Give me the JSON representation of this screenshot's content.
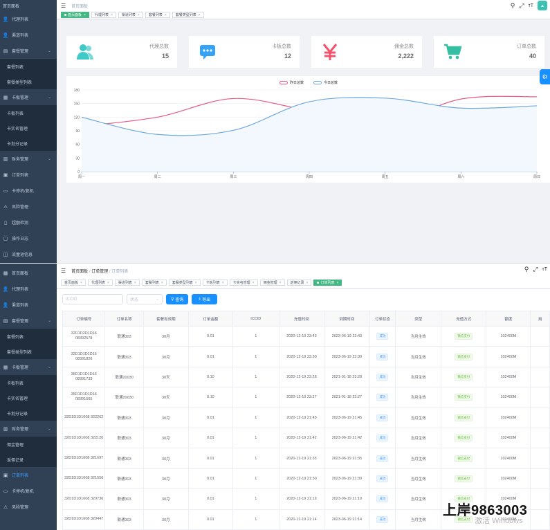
{
  "top": {
    "sidebar": {
      "logo": "首页面板",
      "items": [
        {
          "icon": "user-icon",
          "label": "代理列表",
          "sub": false
        },
        {
          "icon": "user-icon",
          "label": "渠道列表",
          "sub": false
        },
        {
          "icon": "package-icon",
          "label": "套餐管理",
          "sub": false,
          "arrow": true
        },
        {
          "icon": "",
          "label": "套餐列表",
          "sub": true
        },
        {
          "icon": "",
          "label": "套餐类型列表",
          "sub": true
        },
        {
          "icon": "grid-icon",
          "label": "卡板管理",
          "sub": false,
          "arrow": true
        },
        {
          "icon": "",
          "label": "卡板列表",
          "sub": true
        },
        {
          "icon": "",
          "label": "卡实名管理",
          "sub": true
        },
        {
          "icon": "",
          "label": "卡划分记录",
          "sub": true
        },
        {
          "icon": "chart-icon",
          "label": "财务管理",
          "sub": false,
          "arrow": true
        },
        {
          "icon": "cart-icon",
          "label": "订单列表",
          "sub": false
        },
        {
          "icon": "phone-icon",
          "label": "卡停机/复机",
          "sub": false
        },
        {
          "icon": "warn-icon",
          "label": "风险管理",
          "sub": false
        },
        {
          "icon": "doc-icon",
          "label": "超额检测",
          "sub": false
        },
        {
          "icon": "log-icon",
          "label": "操作日志",
          "sub": false
        },
        {
          "icon": "msg-icon",
          "label": "流量池信息",
          "sub": false
        }
      ]
    },
    "breadcrumb": [
      "首页面板"
    ],
    "tags": [
      {
        "label": "首页面板",
        "active": true
      },
      {
        "label": "代理列表",
        "active": false
      },
      {
        "label": "渠道列表",
        "active": false
      },
      {
        "label": "套餐列表",
        "active": false
      },
      {
        "label": "套餐类型列表",
        "active": false
      }
    ],
    "cards": [
      {
        "icon": "users-icon",
        "name": "代理总数",
        "value": "15",
        "color": "#40c9c6"
      },
      {
        "icon": "message-icon",
        "name": "卡板总数",
        "value": "12",
        "color": "#36a3f7"
      },
      {
        "icon": "yen-icon",
        "name": "佣金总数",
        "value": "2,222",
        "color": "#f4516c"
      },
      {
        "icon": "shopping-cart-icon",
        "name": "订单总数",
        "value": "40",
        "color": "#34bfa3"
      }
    ]
  },
  "chart_data": {
    "type": "line",
    "categories": [
      "周一",
      "周二",
      "周三",
      "周四",
      "周五",
      "周六",
      "周日"
    ],
    "series": [
      {
        "name": "昨日总数",
        "values": [
          100,
          120,
          161,
          134,
          105,
          160,
          165
        ],
        "color": "#e85a86"
      },
      {
        "name": "今日总数",
        "values": [
          120,
          82,
          91,
          154,
          162,
          140,
          145
        ],
        "color": "#6fa8dc"
      }
    ],
    "ylim": [
      0,
      180
    ],
    "yticks": [
      "0",
      "30",
      "60",
      "90",
      "120",
      "150",
      "180"
    ],
    "legend": "top-center",
    "grid": true
  },
  "bottom": {
    "sidebar": {
      "items": [
        {
          "icon": "dashboard-icon",
          "label": "首页面板",
          "sub": false
        },
        {
          "icon": "user-icon",
          "label": "代理列表",
          "sub": false
        },
        {
          "icon": "user-icon",
          "label": "渠道列表",
          "sub": false
        },
        {
          "icon": "package-icon",
          "label": "套餐管理",
          "sub": false,
          "arrow": true
        },
        {
          "icon": "",
          "label": "套餐列表",
          "sub": true
        },
        {
          "icon": "",
          "label": "套餐类型列表",
          "sub": true
        },
        {
          "icon": "grid-icon",
          "label": "卡板管理",
          "sub": false,
          "arrow": true
        },
        {
          "icon": "",
          "label": "卡板列表",
          "sub": true
        },
        {
          "icon": "",
          "label": "卡实名管理",
          "sub": true
        },
        {
          "icon": "",
          "label": "卡划分记录",
          "sub": true
        },
        {
          "icon": "chart-icon",
          "label": "财务管理",
          "sub": false,
          "arrow": true
        },
        {
          "icon": "",
          "label": "佣金管理",
          "sub": true
        },
        {
          "icon": "",
          "label": "返佣记录",
          "sub": true
        },
        {
          "icon": "cart-icon",
          "label": "订单列表",
          "sub": false,
          "active": true
        },
        {
          "icon": "phone-icon",
          "label": "卡停机/复机",
          "sub": false
        },
        {
          "icon": "warn-icon",
          "label": "风险管理",
          "sub": false
        }
      ]
    },
    "breadcrumb": [
      "首页面板",
      "订单管理",
      "订单列表"
    ],
    "tags": [
      {
        "label": "首页面板",
        "active": false
      },
      {
        "label": "代理列表",
        "active": false
      },
      {
        "label": "渠道列表",
        "active": false
      },
      {
        "label": "套餐列表",
        "active": false
      },
      {
        "label": "套餐类型列表",
        "active": false
      },
      {
        "label": "卡板列表",
        "active": false
      },
      {
        "label": "卡实名管理",
        "active": false
      },
      {
        "label": "佣金管理",
        "active": false
      },
      {
        "label": "返佣记录",
        "active": false
      },
      {
        "label": "订单列表",
        "active": true
      }
    ],
    "filter": {
      "iccid_placeholder": "ICCID",
      "status_placeholder": "状态",
      "search_label": "查询",
      "export_label": "导出"
    },
    "columns": [
      "订单编号",
      "订单名称",
      "套餐有效期",
      "订单金额",
      "ICCID",
      "充值时间",
      "到期时间",
      "订单状态",
      "类型",
      "充值方式",
      "额度",
      "用"
    ],
    "rows": [
      [
        "32D1D2D1D16 08392578",
        "联通303",
        "30月",
        "0.01",
        "1",
        "2020-12-19 23:43",
        "2023-06-19 23:43",
        "成功",
        "当月生效",
        "微信支付",
        "102400M"
      ],
      [
        "32D1D1D1D16 08391826",
        "联通303",
        "30月",
        "0.01",
        "1",
        "2020-12-19 23:30",
        "2023-06-19 23:30",
        "成功",
        "当月生效",
        "微信支付",
        "102400M"
      ],
      [
        "35D1D1D1D16 08391733",
        "联通20030",
        "30天",
        "0.10",
        "1",
        "2020-12-19 23:28",
        "2021-01-18 23:28",
        "成功",
        "当月生效",
        "微信支付",
        "102400M"
      ],
      [
        "35D1D1D1D16 08391565",
        "联通20030",
        "30天",
        "0.10",
        "1",
        "2020-12-19 23:27",
        "2021-01-18 23:27",
        "成功",
        "当月生效",
        "微信支付",
        "102400M"
      ],
      [
        "32D1D1D1608 322262",
        "联通303",
        "30月",
        "0.01",
        "1",
        "2020-12-19 21:45",
        "2023-06-19 21:45",
        "成功",
        "当月生效",
        "微信支付",
        "102400M"
      ],
      [
        "32D1D1D1608 322120",
        "联通303",
        "30月",
        "0.01",
        "1",
        "2020-12-19 21:42",
        "2023-06-19 21:42",
        "成功",
        "当月生效",
        "微信支付",
        "102400M"
      ],
      [
        "32D1D1D1608 321697",
        "联通303",
        "30月",
        "0.01",
        "1",
        "2020-12-19 21:35",
        "2023-06-19 21:35",
        "成功",
        "当月生效",
        "微信支付",
        "102400M"
      ],
      [
        "32D1D1D1608 321556",
        "联通303",
        "30月",
        "0.01",
        "1",
        "2020-12-19 21:30",
        "2023-06-19 21:30",
        "成功",
        "当月生效",
        "微信支付",
        "102400M"
      ],
      [
        "32D1D1D1608 320736",
        "联通303",
        "30月",
        "0.01",
        "1",
        "2020-12-19 21:19",
        "2023-06-19 21:19",
        "成功",
        "当月生效",
        "微信支付",
        "102400M"
      ],
      [
        "32D1D1D1608 320447",
        "联通303",
        "30月",
        "0.01",
        "1",
        "2020-12-19 21:14",
        "2023-06-19 21:14",
        "成功",
        "当月生效",
        "微信支付",
        "102400M"
      ]
    ]
  },
  "watermark": {
    "text": "上岸9863003",
    "windows_text": "激活 Windows"
  }
}
